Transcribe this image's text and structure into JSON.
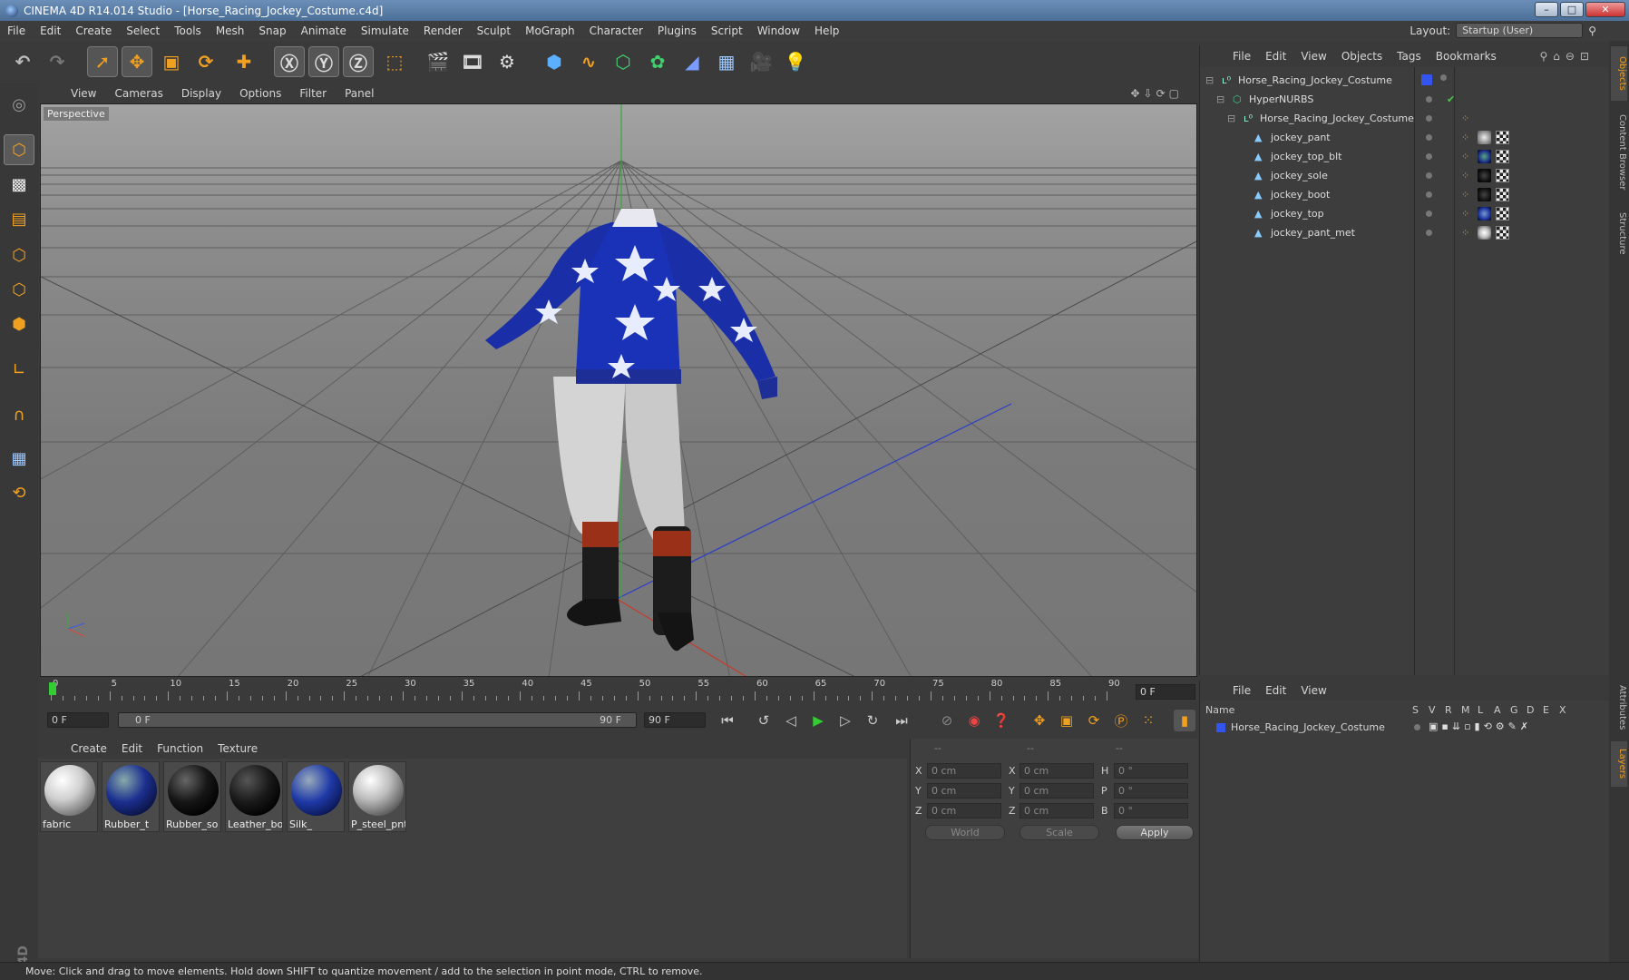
{
  "window": {
    "title": "CINEMA 4D R14.014 Studio - [Horse_Racing_Jockey_Costume.c4d]"
  },
  "menubar": {
    "items": [
      "File",
      "Edit",
      "Create",
      "Select",
      "Tools",
      "Mesh",
      "Snap",
      "Animate",
      "Simulate",
      "Render",
      "Sculpt",
      "MoGraph",
      "Character",
      "Plugins",
      "Script",
      "Window",
      "Help"
    ]
  },
  "layout": {
    "label": "Layout:",
    "value": "Startup (User)"
  },
  "viewport": {
    "menu": [
      "View",
      "Cameras",
      "Display",
      "Options",
      "Filter",
      "Panel"
    ],
    "label": "Perspective"
  },
  "timeline": {
    "ticks": [
      "0",
      "5",
      "10",
      "15",
      "20",
      "25",
      "30",
      "35",
      "40",
      "45",
      "50",
      "55",
      "60",
      "65",
      "70",
      "75",
      "80",
      "85",
      "90"
    ],
    "frame_end_display": "0 F",
    "current_frame": "0 F",
    "range_start": "0 F",
    "range_end": "90 F",
    "max_frame": "90 F"
  },
  "materials": {
    "menu": [
      "Create",
      "Edit",
      "Function",
      "Texture"
    ],
    "items": [
      {
        "name": "fabric",
        "color": "#d8d8d8"
      },
      {
        "name": "Rubber_t",
        "color": "#1b2f8f"
      },
      {
        "name": "Rubber_so",
        "color": "#161616"
      },
      {
        "name": "Leather_bo",
        "color": "#1a1a1a"
      },
      {
        "name": "Silk_",
        "color": "#1f3aa8"
      },
      {
        "name": "P_steel_pnt",
        "color": "#bdbdbd"
      }
    ]
  },
  "coordinates": {
    "headers": [
      "--",
      "--",
      "--"
    ],
    "rows": [
      {
        "a": "X",
        "v1": "0 cm",
        "b": "X",
        "v2": "0 cm",
        "c": "H",
        "v3": "0 °"
      },
      {
        "a": "Y",
        "v1": "0 cm",
        "b": "Y",
        "v2": "0 cm",
        "c": "P",
        "v3": "0 °"
      },
      {
        "a": "Z",
        "v1": "0 cm",
        "b": "Z",
        "v2": "0 cm",
        "c": "B",
        "v3": "0 °"
      }
    ],
    "mode": "World",
    "mode2": "Scale",
    "apply": "Apply"
  },
  "objects": {
    "menu": [
      "File",
      "Edit",
      "View",
      "Objects",
      "Tags",
      "Bookmarks"
    ],
    "tree": [
      {
        "name": "Horse_Racing_Jockey_Costume",
        "level": 0,
        "icon": "null-icon"
      },
      {
        "name": "HyperNURBS",
        "level": 1,
        "icon": "hypernurbs-icon"
      },
      {
        "name": "Horse_Racing_Jockey_Costume",
        "level": 2,
        "icon": "null-icon"
      },
      {
        "name": "jockey_pant",
        "level": 3,
        "icon": "polygon-icon",
        "mat": "#cccccc"
      },
      {
        "name": "jockey_top_blt",
        "level": 3,
        "icon": "polygon-icon",
        "mat": "#1d2f8c"
      },
      {
        "name": "jockey_sole",
        "level": 3,
        "icon": "polygon-icon",
        "mat": "#111111"
      },
      {
        "name": "jockey_boot",
        "level": 3,
        "icon": "polygon-icon",
        "mat": "#141414"
      },
      {
        "name": "jockey_top",
        "level": 3,
        "icon": "polygon-icon",
        "mat": "#1d33a0"
      },
      {
        "name": "jockey_pant_met",
        "level": 3,
        "icon": "polygon-icon",
        "mat": "#bcbcbc"
      }
    ]
  },
  "layers": {
    "menu": [
      "File",
      "Edit",
      "View"
    ],
    "columns": [
      "Name",
      "S",
      "V",
      "R",
      "M",
      "L",
      "A",
      "G",
      "D",
      "E",
      "X"
    ],
    "rows": [
      {
        "name": "Horse_Racing_Jockey_Costume",
        "color": "#3355ee"
      }
    ]
  },
  "right_tabs": [
    "Objects",
    "Content Browser",
    "Structure",
    "Attributes",
    "Layers"
  ],
  "status": "Move: Click and drag to move elements. Hold down SHIFT to quantize movement / add to the selection in point mode, CTRL to remove.",
  "colors": {
    "accent": "#f0a020",
    "selection": "#3355ee",
    "background": "#3a3a3a"
  }
}
